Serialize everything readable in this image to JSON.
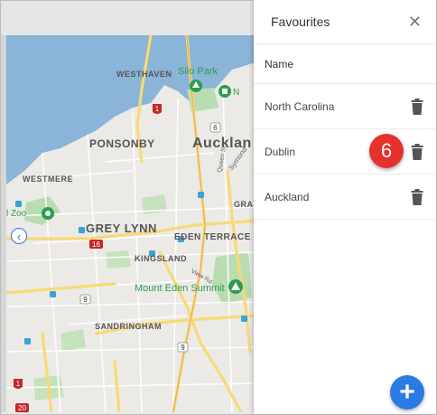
{
  "panel": {
    "title": "Favourites",
    "close_symbol": "✕",
    "column_header": "Name",
    "items": [
      {
        "label": "North Carolina"
      },
      {
        "label": "Dublin"
      },
      {
        "label": "Auckland"
      }
    ]
  },
  "annotation": {
    "step_number": "6"
  },
  "add_button": {
    "symbol": "+"
  },
  "collapse_button": {
    "symbol": "‹"
  },
  "map": {
    "labels": {
      "westhaven": "WESTHAVEN",
      "silo_park": "Silo Park",
      "ponsonby": "PONSONBY",
      "auckland": "Aucklan",
      "westmere": "WESTMERE",
      "grey_lynn": "GREY LYNN",
      "eden_terrace": "EDEN TERRACE",
      "kingsland": "KINGSLAND",
      "grafton": "GRAFT",
      "mount_eden_summit": "Mount Eden Summit",
      "sandringham": "SANDRINGHAM",
      "zoo": "l Zoo",
      "new": "N",
      "symonds": "Symond",
      "queen_st": "Queen St",
      "view_rd": "View Rd"
    },
    "route_markers": [
      "1",
      "6",
      "16",
      "9",
      "9",
      "1",
      "20"
    ]
  },
  "colors": {
    "water": "#8ab4d8",
    "land": "#eceae6",
    "park": "#b9dcb0",
    "road_major": "#f7d978",
    "badge": "#e5322d",
    "fab": "#2a7be4"
  }
}
